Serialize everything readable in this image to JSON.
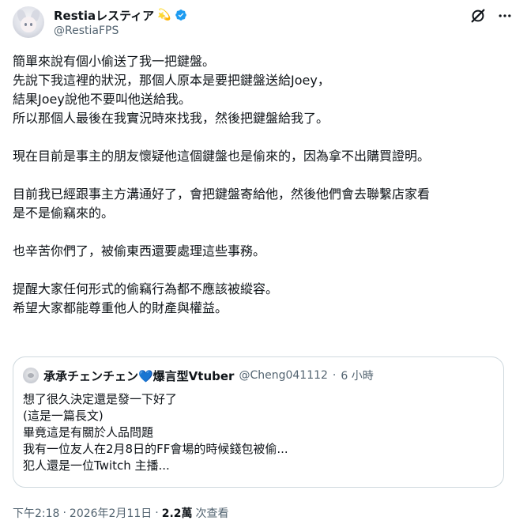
{
  "author": {
    "display_name": "Restiaレスティア",
    "name_emoji": "💫",
    "handle": "@RestiaFPS"
  },
  "tweet": {
    "text": "簡單來說有個小偷送了我一把鍵盤。\n先說下我這裡的狀況，那個人原本是要把鍵盤送給Joey，\n結果Joey說他不要叫他送給我。\n所以那個人最後在我實況時來找我，然後把鍵盤給我了。\n\n現在目前是事主的朋友懷疑他這個鍵盤也是偷來的，因為拿不出購買證明。\n\n目前我已經跟事主方溝通好了，會把鍵盤寄給他，然後他們會去聯繫店家看\n是不是偷竊來的。\n\n也辛苦你們了，被偷東西還要處理這些事務。\n\n提醒大家任何形式的偷竊行為都不應該被縱容。\n希望大家都能尊重他人的財產與權益。"
  },
  "quote": {
    "display_name": "承承チェンチェン💙爆言型Vtuber",
    "handle": "@Cheng041112",
    "separator": "·",
    "time": "6 小時",
    "text": "想了很久決定還是發一下好了\n(這是一篇長文)\n畢竟這是有關於人品問題\n我有一位友人在2月8日的FF會場的時候錢包被偷...\n犯人還是一位Twitch 主播..."
  },
  "meta": {
    "time": "下午2:18",
    "separator": "·",
    "date": "2026年2月11日",
    "views_count": "2.2萬",
    "views_label": "次查看"
  },
  "colors": {
    "text": "#0f1419",
    "secondary": "#536471",
    "verified": "#1d9bf0",
    "border": "#cfd9de"
  },
  "icons": [
    "verified-badge-icon",
    "grok-icon",
    "more-icon"
  ]
}
